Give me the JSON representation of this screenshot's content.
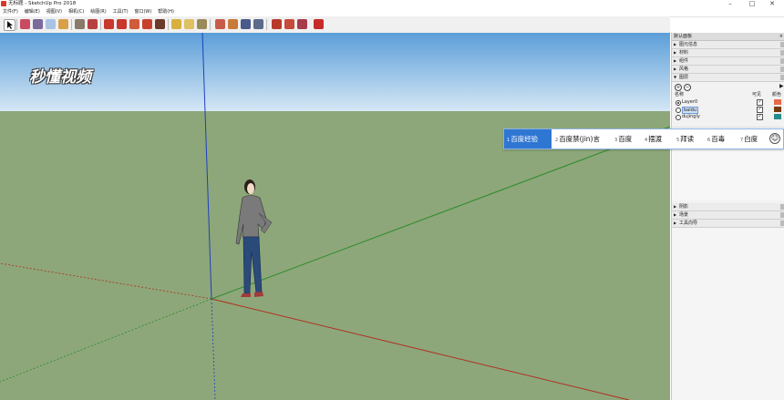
{
  "window": {
    "title": "无标题 - SketchUp Pro 2018",
    "min": "–",
    "max": "□",
    "close": "✕"
  },
  "menu": [
    "文件(F)",
    "编辑(E)",
    "视图(V)",
    "相机(C)",
    "绘图(R)",
    "工具(T)",
    "窗口(W)",
    "帮助(H)"
  ],
  "logo_text": "秒懂视频",
  "tray": {
    "title": "默认面板",
    "close": "×",
    "sections_top": [
      "图元信息",
      "材料",
      "组件",
      "风格"
    ],
    "layers_section": "图层",
    "add": "+",
    "remove": "−",
    "col_name": "名称",
    "col_visible": "可见",
    "col_color": "颜色",
    "layers": [
      {
        "name": "Layer0",
        "active": true,
        "visible": true,
        "color": "#e86a4a"
      },
      {
        "name": "baidu",
        "active": false,
        "visible": true,
        "color": "#7a3a10"
      },
      {
        "name": "dujingly",
        "active": false,
        "visible": true,
        "color": "#2a8a8a"
      }
    ],
    "sections_bottom": [
      "阴影",
      "场景",
      "工具向导"
    ]
  },
  "ime": {
    "candidates": [
      {
        "num": "1",
        "text": "百度经验"
      },
      {
        "num": "2",
        "text": "百度禁(jin)言"
      },
      {
        "num": "3",
        "text": "百度"
      },
      {
        "num": "4",
        "text": "摆渡"
      },
      {
        "num": "5",
        "text": "拜读"
      },
      {
        "num": "6",
        "text": "百毒"
      },
      {
        "num": "7",
        "text": "白度"
      }
    ],
    "emoji": "☺"
  },
  "colors": {
    "sky_top": "#5b9ed8",
    "sky_bottom": "#d2e5f4",
    "ground": "#8da77a",
    "axis_blue": "#1f3fbf",
    "axis_red": "#b03020",
    "axis_green": "#2c8a2c",
    "ime_selected": "#2f76d2"
  }
}
